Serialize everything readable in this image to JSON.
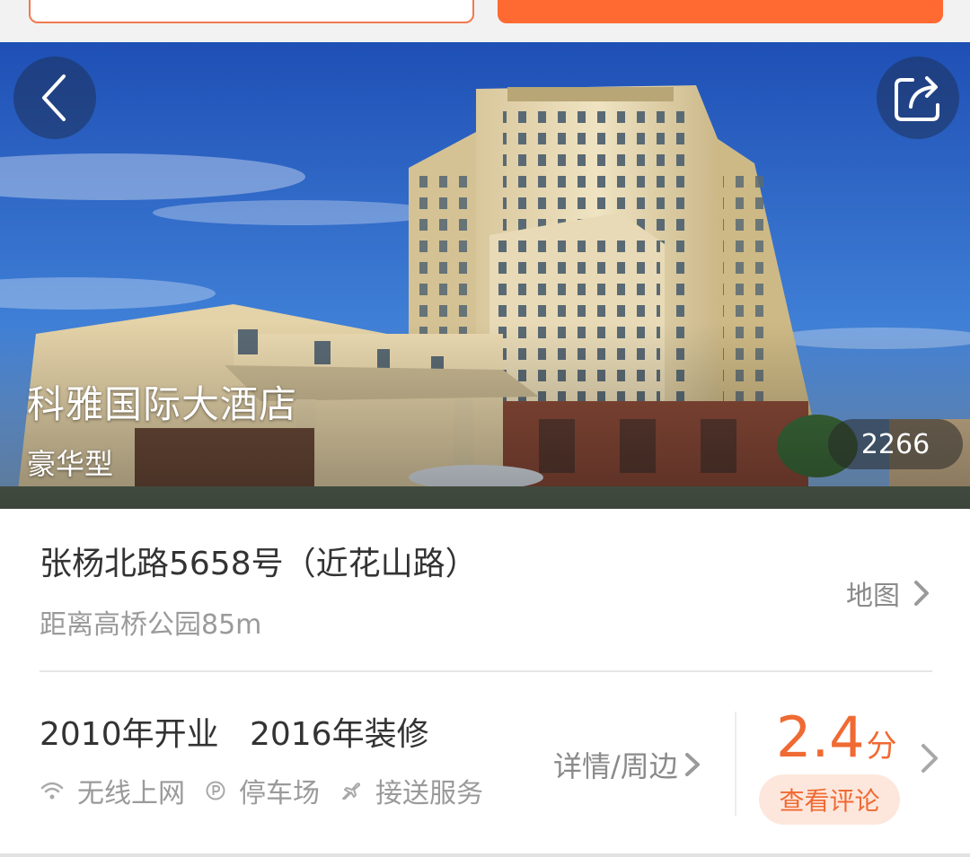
{
  "hotel": {
    "name": "科雅国际大酒店",
    "type": "豪华型",
    "photo_count": "2266"
  },
  "location": {
    "address": "张杨北路5658号（近花山路）",
    "distance": "距离高桥公园85m",
    "map_label": "地图"
  },
  "details": {
    "years": "2010年开业   2016年装修",
    "facilities": [
      {
        "icon": "wifi-icon",
        "label": "无线上网"
      },
      {
        "icon": "parking-icon",
        "label": "停车场"
      },
      {
        "icon": "plane-icon",
        "label": "接送服务"
      }
    ],
    "detail_label": "详情/周边"
  },
  "rating": {
    "score": "2.4",
    "unit": "分",
    "review_label": "查看评论"
  },
  "colors": {
    "accent": "#f06a33",
    "top_button": "#ff6a32"
  }
}
